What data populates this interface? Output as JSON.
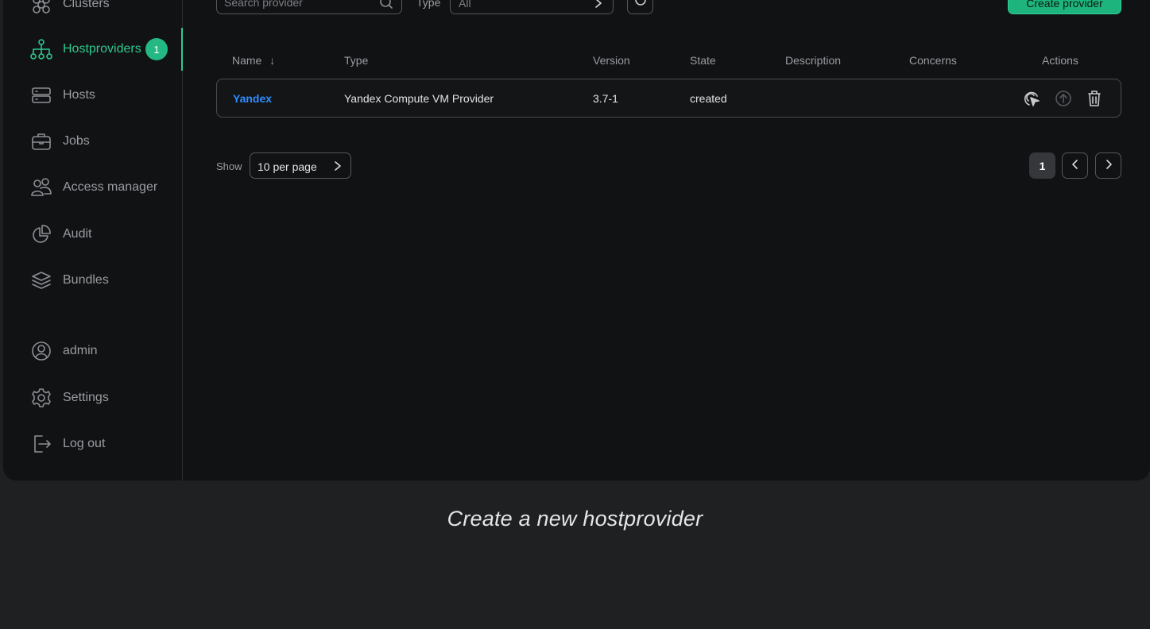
{
  "sidebar": {
    "items": [
      {
        "label": "Clusters",
        "icon": "clusters-icon"
      },
      {
        "label": "Hostproviders",
        "icon": "hostproviders-icon",
        "badge": "1",
        "active": true
      },
      {
        "label": "Hosts",
        "icon": "hosts-icon"
      },
      {
        "label": "Jobs",
        "icon": "jobs-icon"
      },
      {
        "label": "Access manager",
        "icon": "access-manager-icon"
      },
      {
        "label": "Audit",
        "icon": "audit-icon"
      },
      {
        "label": "Bundles",
        "icon": "bundles-icon"
      }
    ],
    "bottom_items": [
      {
        "label": "admin",
        "icon": "user-icon"
      },
      {
        "label": "Settings",
        "icon": "gear-icon"
      },
      {
        "label": "Log out",
        "icon": "logout-icon"
      }
    ]
  },
  "toolbar": {
    "search_placeholder": "Search provider",
    "type_label": "Type",
    "type_value": "All",
    "create_label": "Create provider"
  },
  "table": {
    "columns": [
      "Name",
      "Type",
      "Version",
      "State",
      "Description",
      "Concerns",
      "Actions"
    ],
    "sort_indicator": "↓",
    "rows": [
      {
        "name": "Yandex",
        "type": "Yandex Compute VM Provider",
        "version": "3.7-1",
        "state": "created",
        "description": "",
        "concerns": ""
      }
    ]
  },
  "pagination": {
    "show_label": "Show",
    "per_page": "10 per page",
    "current_page": "1"
  },
  "caption": "Create a new hostprovider",
  "colors": {
    "accent": "#2dc98f",
    "link": "#2f8dff",
    "background": "#111214"
  }
}
